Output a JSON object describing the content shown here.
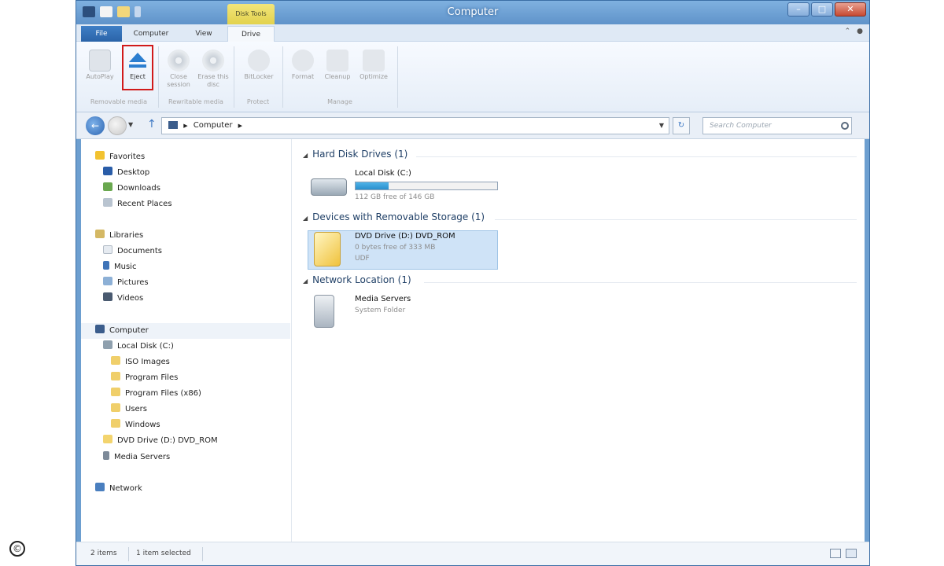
{
  "window": {
    "title": "Computer",
    "contextual_tab_group": "Disk Tools"
  },
  "ribbon_tabs": {
    "file": "File",
    "computer": "Computer",
    "view": "View",
    "drive": "Drive"
  },
  "ribbon": {
    "buttons": {
      "autoplay": "AutoPlay",
      "eject": "Eject",
      "close_session": "Close session",
      "erase_disc": "Erase this disc",
      "bitlocker": "BitLocker",
      "format": "Format",
      "cleanup": "Cleanup",
      "optimize": "Optimize"
    },
    "groups": {
      "removable_media": "Removable media",
      "rewritable_media": "Rewritable media",
      "protect": "Protect",
      "manage": "Manage"
    }
  },
  "address": {
    "path": "Computer",
    "search_placeholder": "Search Computer"
  },
  "nav": {
    "favorites": "Favorites",
    "desktop": "Desktop",
    "downloads": "Downloads",
    "recent_places": "Recent Places",
    "libraries": "Libraries",
    "documents": "Documents",
    "music": "Music",
    "pictures": "Pictures",
    "videos": "Videos",
    "computer": "Computer",
    "local_disk": "Local Disk (C:)",
    "iso_images": "ISO Images",
    "program_files": "Program Files",
    "program_files_x86": "Program Files (x86)",
    "users": "Users",
    "windows": "Windows",
    "dvd_drive": "DVD Drive (D:) DVD_ROM",
    "media_servers": "Media Servers",
    "network": "Network"
  },
  "content": {
    "groups": {
      "hard_disk": "Hard Disk Drives (1)",
      "removable": "Devices with Removable Storage (1)",
      "network": "Network Location (1)"
    },
    "local_disk": {
      "name": "Local Disk (C:)",
      "free": "112 GB free of 146 GB",
      "used_fraction": 0.233
    },
    "dvd": {
      "name": "DVD Drive (D:) DVD_ROM",
      "free": "0 bytes free of 333 MB",
      "fs": "UDF"
    },
    "media_servers": {
      "name": "Media Servers",
      "type": "System Folder"
    }
  },
  "status": {
    "items": "2 items",
    "selected": "1 item selected"
  },
  "colors": {
    "title_bar": "#6d9fd0",
    "contextual_tab": "#e2d24d",
    "eject_highlight": "#d11a1a",
    "capacity_fill": "#2a8fcc",
    "selection": "#cfe3f7"
  }
}
